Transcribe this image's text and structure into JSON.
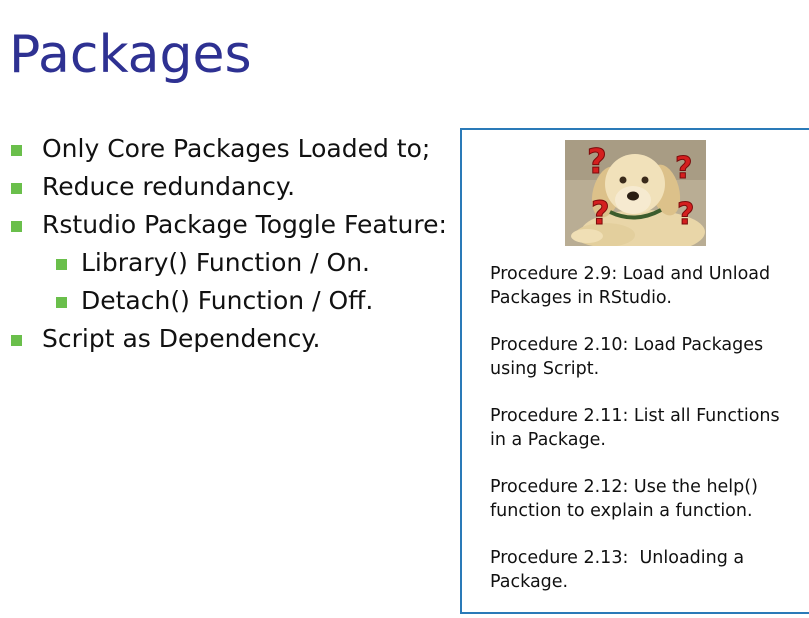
{
  "slide": {
    "title": "Packages"
  },
  "bullets": [
    {
      "level": 1,
      "text": "Only Core Packages Loaded to;"
    },
    {
      "level": 1,
      "text": "Reduce redundancy."
    },
    {
      "level": 1,
      "text": "Rstudio Package Toggle Feature:"
    },
    {
      "level": 2,
      "text": "Library() Function / On."
    },
    {
      "level": 2,
      "text": "Detach() Function / Off."
    },
    {
      "level": 1,
      "text": "Script as Dependency."
    }
  ],
  "sidebar": {
    "image": "confused-labrador-with-question-marks",
    "procedures": [
      "Procedure 2.9: Load and Unload Packages in RStudio.",
      "Procedure 2.10: Load Packages using Script.",
      "Procedure 2.11: List all Functions in a Package.",
      "Procedure 2.12: Use the help() function to explain a function.",
      "Procedure 2.13:  Unloading a Package."
    ]
  },
  "colors": {
    "title": "#2e3192",
    "bullet_marker": "#6abf4b",
    "box_border": "#2a7ab8",
    "question_marks": "#d41f1f"
  }
}
